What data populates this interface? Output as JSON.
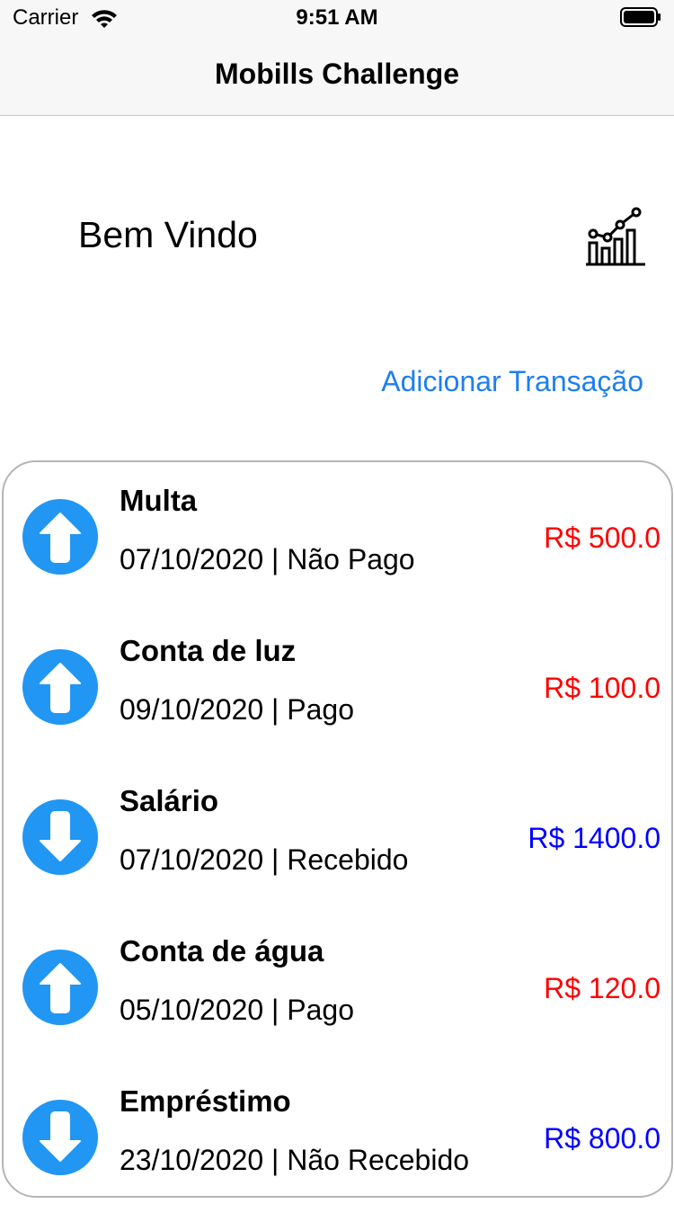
{
  "status_bar": {
    "carrier": "Carrier",
    "time": "9:51 AM"
  },
  "nav": {
    "title": "Mobills Challenge"
  },
  "header": {
    "welcome": "Bem Vindo",
    "chart_icon": "chart-icon"
  },
  "actions": {
    "add_transaction": "Adicionar Transação"
  },
  "colors": {
    "expense": "#ff0000",
    "income": "#0000ff",
    "accent": "#1e7ff0",
    "arrow_circle": "#2196f3"
  },
  "transactions": [
    {
      "title": "Multa",
      "subtitle": "07/10/2020 | Não Pago",
      "value": "R$ 500.0",
      "direction": "up",
      "kind": "expense"
    },
    {
      "title": "Conta de luz",
      "subtitle": "09/10/2020 | Pago",
      "value": "R$ 100.0",
      "direction": "up",
      "kind": "expense"
    },
    {
      "title": "Salário",
      "subtitle": "07/10/2020 | Recebido",
      "value": "R$ 1400.0",
      "direction": "down",
      "kind": "income"
    },
    {
      "title": "Conta de água",
      "subtitle": "05/10/2020 | Pago",
      "value": "R$ 120.0",
      "direction": "up",
      "kind": "expense"
    },
    {
      "title": "Empréstimo",
      "subtitle": "23/10/2020 | Não Recebido",
      "value": "R$ 800.0",
      "direction": "down",
      "kind": "income"
    }
  ]
}
